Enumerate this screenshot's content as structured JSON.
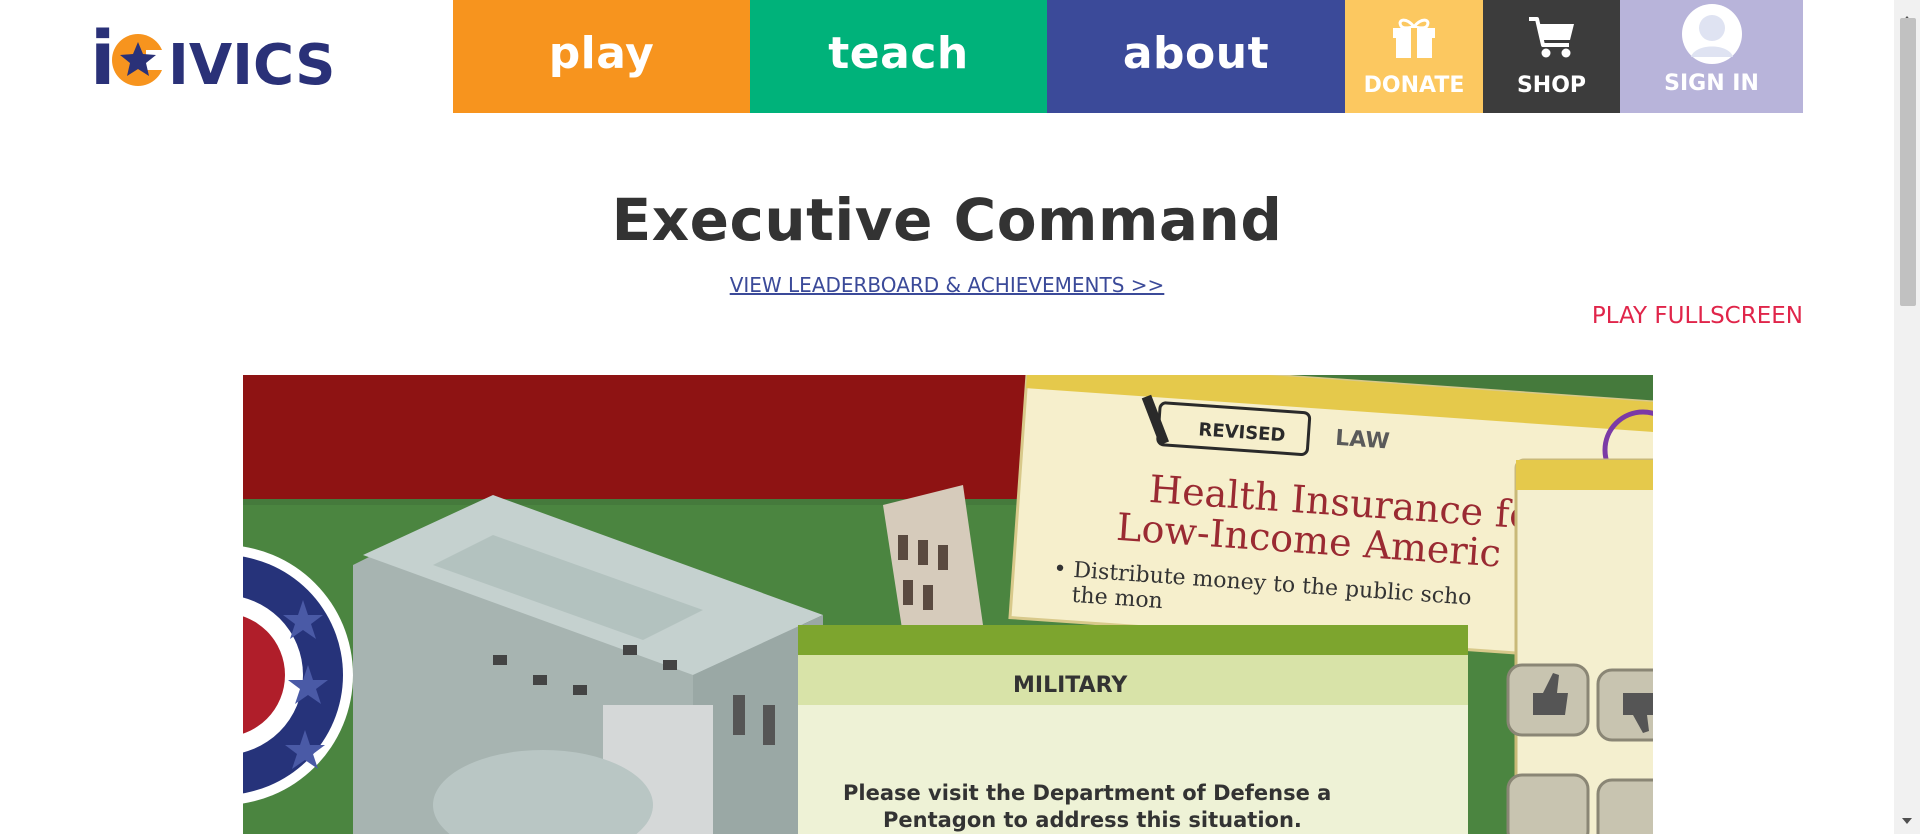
{
  "logo": {
    "text_i": "i",
    "text_rest": "IVICS",
    "colors": {
      "navy": "#2a3178",
      "orange": "#f7941e"
    }
  },
  "nav": {
    "play": "play",
    "teach": "teach",
    "about": "about",
    "donate": "DONATE",
    "shop": "SHOP",
    "signin": "SIGN IN"
  },
  "icons": {
    "donate": "gift-icon",
    "shop": "cart-icon",
    "signin": "avatar-icon"
  },
  "page": {
    "title": "Executive Command",
    "leaderboard_link": "VIEW LEADERBOARD & ACHIEVEMENTS >>",
    "fullscreen": "PLAY FULLSCREEN"
  },
  "game": {
    "law_card": {
      "stamp": "REVISED",
      "type": "LAW",
      "title_line1": "Health Insurance fo",
      "title_line2": "Low-Income Americ",
      "bullet_line1": "• Distribute money to the public scho",
      "bullet_line2": "the mon"
    },
    "military_card": {
      "type": "MILITARY",
      "line1": "Please visit the Department of Defense a",
      "line2": "Pentagon to address this situation."
    }
  },
  "colors": {
    "play": "#f7941e",
    "teach": "#00b27a",
    "about": "#3b4a99",
    "donate": "#fcc860",
    "shop": "#3c3c3c",
    "signin": "#b8b4da",
    "title": "#333333",
    "link": "#3b4a99",
    "fullscreen": "#e0254a"
  }
}
